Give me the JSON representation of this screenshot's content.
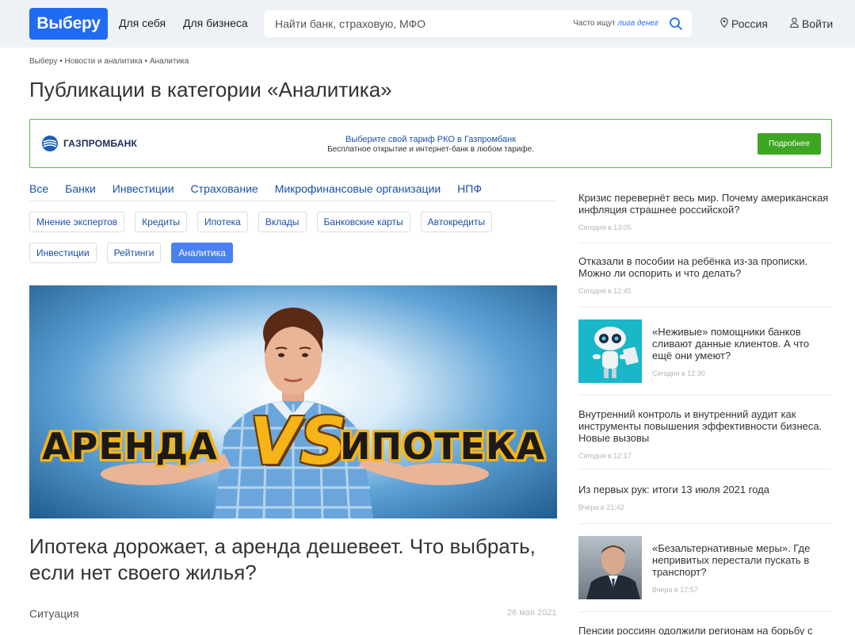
{
  "header": {
    "logo": "Выберу",
    "nav": [
      "Для себя",
      "Для бизнеса"
    ],
    "search": {
      "placeholder": "Найти банк, страховую, МФО",
      "hint_prefix": "Часто ищут",
      "hint_link": "лига денег"
    },
    "region": "Россия",
    "login": "Войти"
  },
  "breadcrumb": "Выберу • Новости и аналитика • Аналитика",
  "page_title": "Публикации в категории «Аналитика»",
  "banner": {
    "brand": "ГАЗПРОМБАНК",
    "title": "Выберите свой тариф РКО в Газпромбанк",
    "subtitle": "Бесплатное открытие и интернет-банк в любом тарифе.",
    "button": "Подробнее",
    "border_color": "#55b94a",
    "button_color": "#3da622"
  },
  "tabs": [
    "Все",
    "Банки",
    "Инвестиции",
    "Страхование",
    "Микрофинансовые организации",
    "НПФ"
  ],
  "tags": [
    {
      "label": "Мнение экспертов",
      "active": false
    },
    {
      "label": "Кредиты",
      "active": false
    },
    {
      "label": "Ипотека",
      "active": false
    },
    {
      "label": "Вклады",
      "active": false
    },
    {
      "label": "Банковские карты",
      "active": false
    },
    {
      "label": "Автокредиты",
      "active": false
    },
    {
      "label": "Инвестиции",
      "active": false
    },
    {
      "label": "Рейтинги",
      "active": false
    },
    {
      "label": "Аналитика",
      "active": true
    }
  ],
  "featured": {
    "image_text": {
      "left": "АРЕНДА",
      "vs": "VS",
      "right": "ИПОТЕКА"
    },
    "title": "Ипотека дорожает, а аренда дешевеет. Что выбрать, если нет своего жилья?",
    "category": "Ситуация",
    "date": "26 мая 2021"
  },
  "sidebar": [
    {
      "title": "Кризис перевернёт весь мир. Почему американская инфляция страшнее российской?",
      "time": "Сегодня в 13:05"
    },
    {
      "title": "Отказали в пособии на ребёнка из-за прописки. Можно ли оспорить и что делать?",
      "time": "Сегодня в 12:45"
    },
    {
      "title": "«Неживые» помощники банков сливают данные клиентов. А что ещё они умеют?",
      "time": "Сегодня в 12:30",
      "image": "robot"
    },
    {
      "title": "Внутренний контроль и внутренний аудит как инструменты повышения эффективности бизнеса. Новые вызовы",
      "time": "Сегодня в 12:17"
    },
    {
      "title": "Из первых рук: итоги 13 июля 2021 года",
      "time": "Вчера в 21:42"
    },
    {
      "title": "«Безальтернативные меры». Где непривитых перестали пускать в транспорт?",
      "time": "Вчера в 17:57",
      "image": "portrait"
    },
    {
      "title": "Пенсии россиян одолжили регионам на борьбу с",
      "time": ""
    }
  ],
  "colors": {
    "brand": "#1f6bf2",
    "link": "#1b50a8",
    "active_tag": "#4a80f0",
    "header_bg": "#eef1f6"
  }
}
